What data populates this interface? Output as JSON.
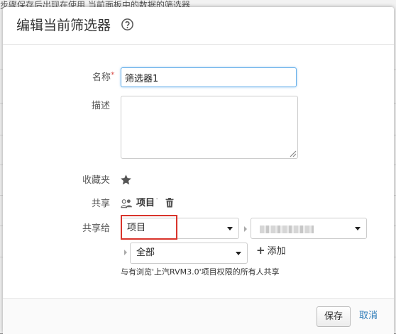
{
  "background": {
    "text": "步骤保存后出现在使用   当前面板中的数据的筛选器"
  },
  "dialog": {
    "title": "编辑当前筛选器",
    "help_icon": "help-circle-icon"
  },
  "form": {
    "name_label": "名称",
    "required_mark": "*",
    "name_value": "筛选器1",
    "desc_label": "描述",
    "desc_value": "",
    "favorite_label": "收藏夹",
    "favorite_icon": "star-icon",
    "share_label": "共享",
    "share_value": "项目",
    "share_to_label": "共享给",
    "share_type_selected": "项目",
    "scope_selected": "全部",
    "add_label": "添加",
    "note": "与有浏览'上汽RVM3.0'项目权限的所有人共享"
  },
  "footer": {
    "save_label": "保存",
    "cancel_label": "取消"
  },
  "colors": {
    "focus_border": "#66afe9",
    "highlight": "#d9342b",
    "link": "#2a7ab8"
  }
}
